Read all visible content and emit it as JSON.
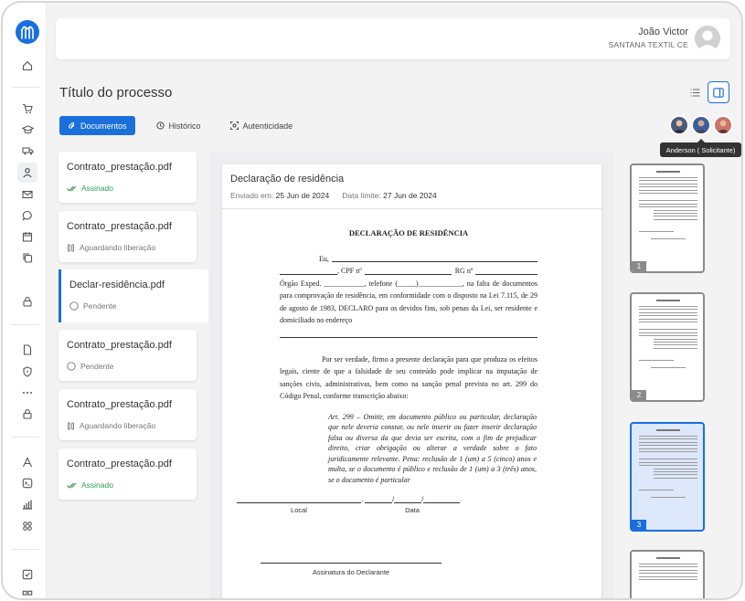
{
  "brand": {
    "accent": "#1a6fdc",
    "success": "#2e9b4e"
  },
  "sidebar": {
    "items": [
      {
        "name": "home-icon"
      },
      {
        "name": "cart-icon"
      },
      {
        "name": "graduation-cap-icon"
      },
      {
        "name": "truck-icon"
      },
      {
        "name": "user-icon"
      },
      {
        "name": "mail-icon"
      },
      {
        "name": "chat-icon"
      },
      {
        "name": "calendar-icon"
      },
      {
        "name": "copy-icon"
      },
      {
        "name": "lock-icon"
      },
      {
        "name": "file-icon"
      },
      {
        "name": "shield-icon"
      },
      {
        "name": "more-icon"
      },
      {
        "name": "lock-icon"
      },
      {
        "name": "font-icon"
      },
      {
        "name": "terminal-icon"
      },
      {
        "name": "bar-chart-icon"
      },
      {
        "name": "grid-icon"
      },
      {
        "name": "checkbox-icon"
      }
    ]
  },
  "user": {
    "name": "João Victor",
    "company": "SANTANA TEXTIL CE"
  },
  "page": {
    "title": "Título do processo"
  },
  "tabs": [
    {
      "label": "Documentos",
      "icon": "paperclip-icon"
    },
    {
      "label": "Histórico",
      "icon": "history-icon"
    },
    {
      "label": "Autenticidade",
      "icon": "scan-icon"
    }
  ],
  "signers": {
    "tooltip": "Anderson ( Solicitante)"
  },
  "documents": [
    {
      "name": "Contrato_prestação.pdf",
      "status": "Assinado",
      "state": "signed"
    },
    {
      "name": "Contrato_prestação.pdf",
      "status": "Aguardando liberação",
      "state": "waiting"
    },
    {
      "name": "Declar-residência.pdf",
      "status": "Pendente",
      "state": "pending"
    },
    {
      "name": "Contrato_prestação.pdf",
      "status": "Pendente",
      "state": "pending"
    },
    {
      "name": "Contrato_prestação.pdf",
      "status": "Aguardando liberação",
      "state": "waiting"
    },
    {
      "name": "Contrato_prestação.pdf",
      "status": "Assinado",
      "state": "signed"
    }
  ],
  "viewer": {
    "title": "Declaração de residência",
    "sent_label": "Enviado em:",
    "sent_date": "25 Jun de 2024",
    "limit_label": "Data limite:",
    "limit_date": "27 Jun de 2024"
  },
  "declaration": {
    "title": "DECLARAÇÃO DE RESIDÊNCIA",
    "line_eu": "Eu,",
    "line_cpf": ", CPF nº",
    "line_rg": "RG nº",
    "paragraph1": "Órgão Exped. ___________, telefone (_____)____________, na falta de documentos para comprovação de residência, em conformidade com o disposto na Lei 7.115, de 29 de agosto de 1983, DECLARO para os devidos fins, sob penas da Lei, ser residente e domiciliado no endereço",
    "paragraph2": "Por ser verdade, firmo a presente declaração para que produza os efeitos legais, ciente de que a falsidade de seu conteúdo pode implicar na imputação de sanções civis, administrativas, bem como na sanção penal prevista no art. 299 do Código Penal, conforme transcrição abaixo:",
    "article": "Art. 299 – Omitir, em documento público ou particular, declaração que nele deveria constar, ou nele inserir ou fazer inserir declaração falsa ou diversa da que devia ser escrita, com o fim de prejudicar direito, criar obrigação ou alterar a verdade sobre o fato juridicamente relevante. Pena: reclusão de 1 (um) a 5 (cinco) anos e multa, se o documento é público e reclusão de 1 (um) a 3 (três) anos, se o documento é particular",
    "local_label": "Local",
    "date_label": "Data",
    "signature_label": "Assinatura do Declarante"
  },
  "thumbnails": [
    {
      "page": "1"
    },
    {
      "page": "2"
    },
    {
      "page": "3"
    }
  ]
}
